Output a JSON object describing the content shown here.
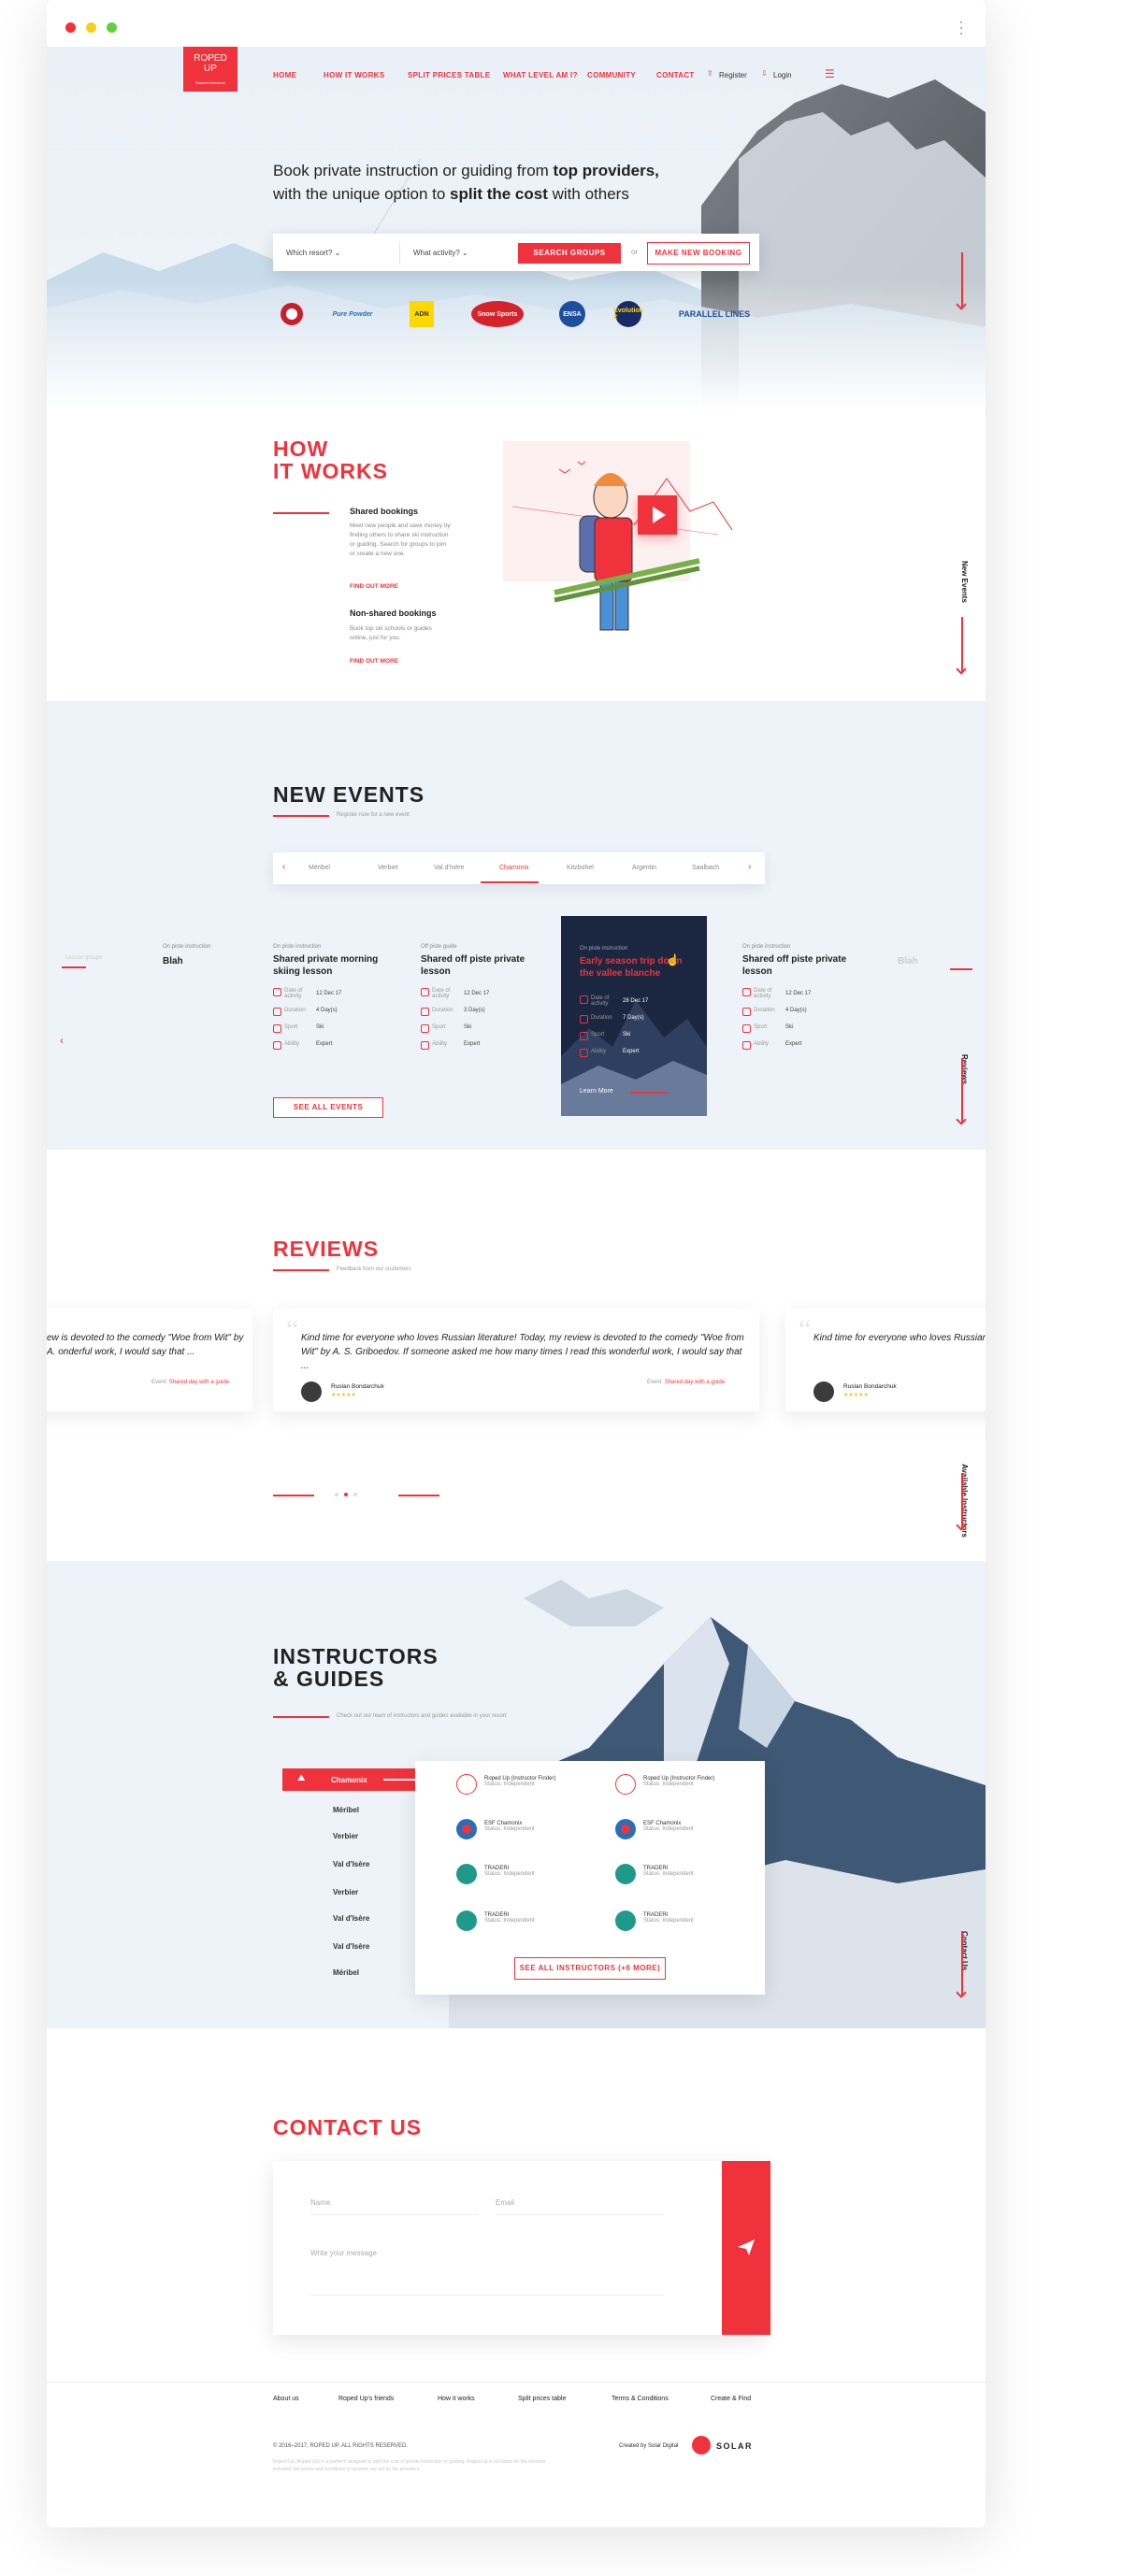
{
  "brand": {
    "logo_line1": "ROPED",
    "logo_line2": "UP",
    "logo_tag": "Shared Adventure",
    "accent": "#f0323c"
  },
  "nav": {
    "items": [
      "HOME",
      "HOW IT WORKS",
      "SPLIT PRICES TABLE",
      "WHAT LEVEL AM I?",
      "COMMUNITY",
      "CONTACT"
    ],
    "register": "Register",
    "login": "Login"
  },
  "hero": {
    "headline_a": "Book private instruction or guiding from ",
    "headline_b": "top providers,",
    "headline_c": "with the unique option to ",
    "headline_d": "split the cost",
    "headline_e": " with others",
    "resort_placeholder": "Which resort?",
    "activity_placeholder": "What activity?",
    "search_label": "SEARCH GROUPS",
    "or_label": "or",
    "booking_label": "MAKE NEW BOOKING",
    "partners": [
      "ESF",
      "Pure Powder",
      "ADN",
      "Snow Sports",
      "ENSA",
      "Evolution 2",
      "PARALLEL LINES"
    ]
  },
  "how": {
    "title_1": "HOW",
    "title_2": "IT WORKS",
    "shared_title": "Shared bookings",
    "shared_text": "Meet new people and save money by finding others to share ski instruction or guiding. Search for groups to join or create a new one.",
    "shared_link": "FIND OUT MORE",
    "nonshared_title": "Non-shared bookings",
    "nonshared_text": "Book top ski schools or guides online, just for you.",
    "nonshared_link": "FIND OUT MORE",
    "side_label": "New Events"
  },
  "events": {
    "title": "NEW EVENTS",
    "subtitle": "Register now for a new event",
    "tabs": [
      "Méribel",
      "Verbier",
      "Val d'Isère",
      "Chamonix",
      "Kitzbühel",
      "Argentin",
      "Saalbach"
    ],
    "active_tab": "Chamonix",
    "cards": [
      {
        "sub": "On piste instruction",
        "title": "Shared private morning skiing lesson",
        "date": "12 Dec 17",
        "duration": "4 Day(s)",
        "sport": "Ski",
        "ability": "Expert"
      },
      {
        "sub": "Off piste guide",
        "title": "Shared off piste private lesson",
        "date": "12 Dec 17",
        "duration": "3 Day(s)",
        "sport": "Ski",
        "ability": "Expert"
      },
      {
        "sub": "On piste instruction",
        "title": "Early season trip down the vallee blanche",
        "date": "28 Dec 17",
        "duration": "7 Day(s)",
        "sport": "Ski",
        "ability": "Expert",
        "cta": "Learn More"
      },
      {
        "sub": "On piste instruction",
        "title": "Shared off piste private lesson",
        "date": "12 Dec 17",
        "duration": "4 Day(s)",
        "sport": "Ski",
        "ability": "Expert"
      }
    ],
    "ghost_left_sub": "On piste instruction",
    "ghost_left_title": "Blah",
    "ghost_right_title": "Blah",
    "ghost_left_label": "Lesson groups",
    "labels": {
      "date": "Date of activity",
      "duration": "Duration",
      "sport": "Sport",
      "ability": "Ability"
    },
    "see_all": "SEE ALL EVENTS",
    "side_label": "Reviews"
  },
  "reviews": {
    "title": "REVIEWS",
    "subtitle": "Feedback from our customers",
    "left_text": "ew is devoted to the comedy \"Woe from Wit\" by A. onderful work, I would say that ...",
    "left_event_label": "Event:",
    "left_event": "Shared day with a guide",
    "main_text": "Kind time for everyone who loves Russian literature! Today, my review is devoted to the comedy \"Woe from Wit\" by A. S. Griboedov. If someone asked me how many times I read this wonderful work, I would say that ...",
    "main_author": "Ruslan Bondarchuk",
    "main_event_label": "Event:",
    "main_event": "Shared day with a guide",
    "right_text": "Kind time for everyone who loves Russian liter wonderful work, I would say that ...",
    "right_author": "Ruslan Bondarchuk",
    "stars": "★★★★★",
    "side_label": "Available Instructors"
  },
  "instructors": {
    "title_1": "INSTRUCTORS",
    "title_2": "& GUIDES",
    "subtitle": "Check out our team of instructors and guides available in your resort",
    "locations": [
      "Chamonix",
      "Méribel",
      "Verbier",
      "Val d'Isère",
      "Verbier",
      "Val d'Isère",
      "Val d'Isère",
      "Méribel"
    ],
    "active_location": "Chamonix",
    "list": [
      {
        "name": "Roped Up (Instructor Finder)",
        "status": "Status: Independent"
      },
      {
        "name": "Roped Up (Instructor Finder)",
        "status": "Status: Independent"
      },
      {
        "name": "ESF Chamonix",
        "status": "Status: Independent"
      },
      {
        "name": "ESF Chamonix",
        "status": "Status: Independent"
      },
      {
        "name": "TRADERI",
        "status": "Status: Independent"
      },
      {
        "name": "TRADERI",
        "status": "Status: Independent"
      },
      {
        "name": "TRADERI",
        "status": "Status: Independent"
      },
      {
        "name": "TRADERI",
        "status": "Status: Independent"
      }
    ],
    "see_all": "SEE ALL INSTRUCTORS (+6 MORE)",
    "side_label": "Contact Us"
  },
  "contact": {
    "title": "CONTACT US",
    "name_placeholder": "Name",
    "email_placeholder": "Email",
    "message_placeholder": "Write your message"
  },
  "footer": {
    "links": [
      "About us",
      "Roped Up's friends",
      "How it works",
      "Split prices table",
      "Terms & Conditions",
      "Create & Find"
    ],
    "copyright": "© 2016–2017, ROPED UP. ALL RIGHTS RESERVED.",
    "disclaimer": "Roped Up (Roped Up) is a platform designed to split the cost of private instruction or guiding. Roped Up is not liable for the services provided, the prices and conditions of services are set by the providers.",
    "created_by": "Created by Solar Digital",
    "solar": "SOLAR"
  }
}
